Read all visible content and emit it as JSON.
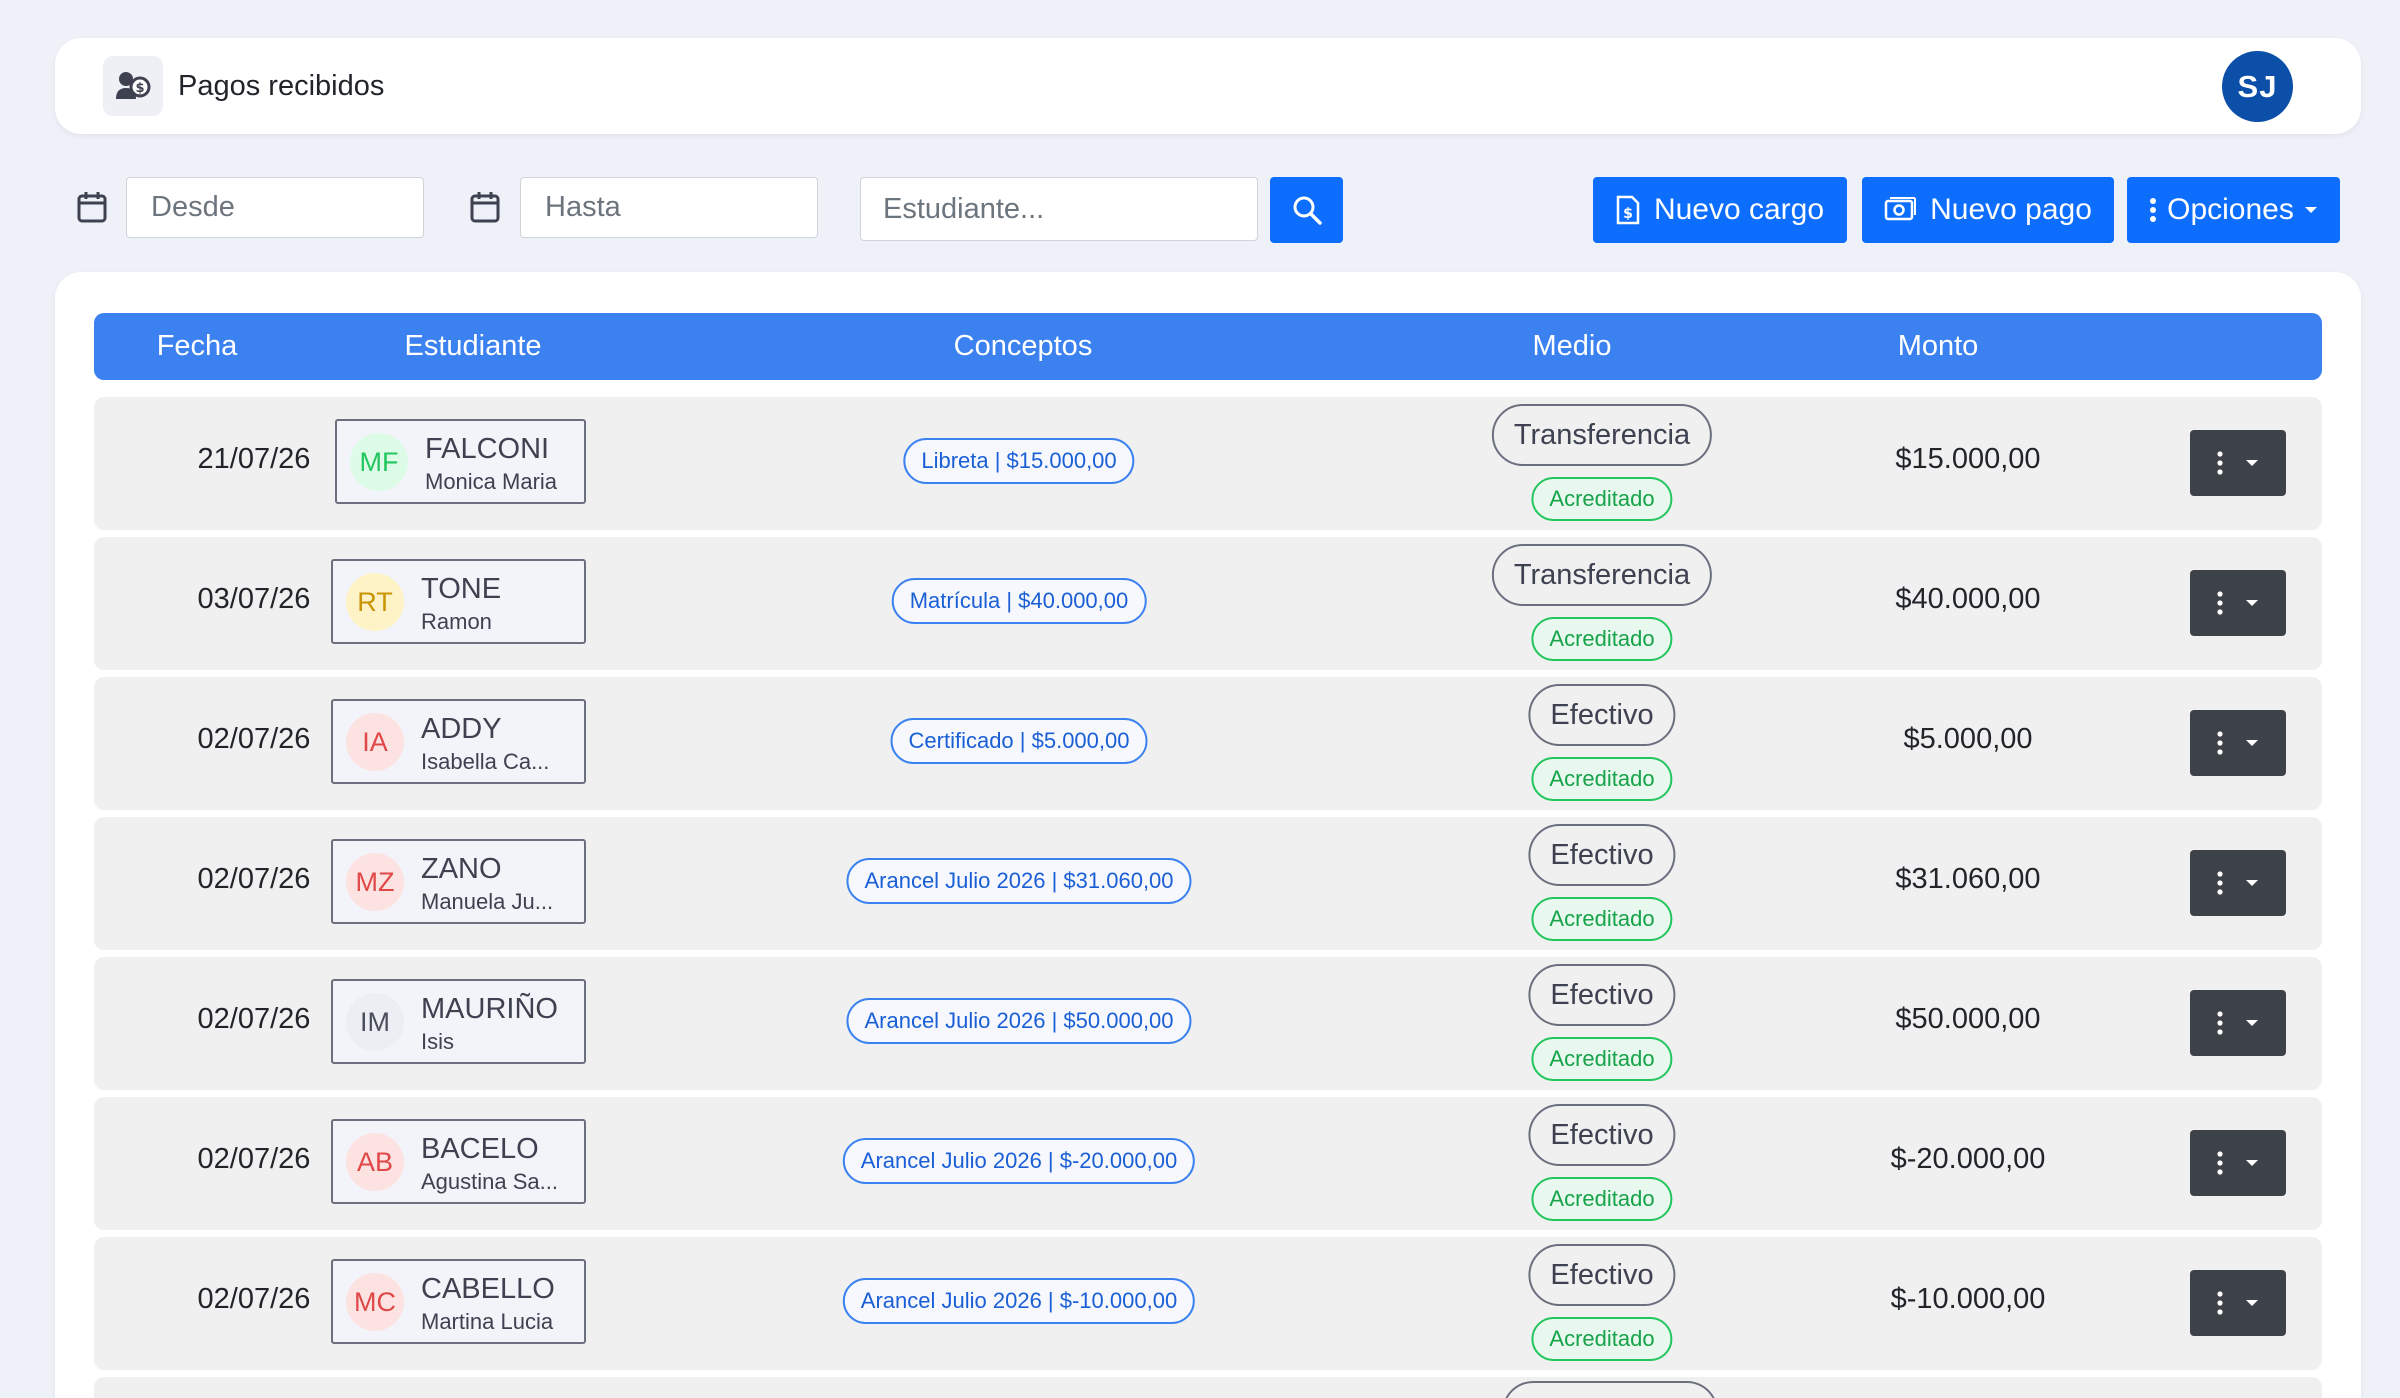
{
  "header": {
    "title": "Pagos recibidos",
    "avatar_initials": "SJ"
  },
  "toolbar": {
    "from_placeholder": "Desde",
    "to_placeholder": "Hasta",
    "student_placeholder": "Estudiante...",
    "new_charge_label": "Nuevo cargo",
    "new_payment_label": "Nuevo pago",
    "options_label": "Opciones"
  },
  "table": {
    "headers": [
      "Fecha",
      "Estudiante",
      "Conceptos",
      "Medio",
      "Monto"
    ],
    "rows": [
      {
        "date": "21/07/26",
        "initials": "MF",
        "last": "FALCONI",
        "first": "Monica Maria",
        "concept": "Libreta | $15.000,00",
        "medio": "Transferencia",
        "status": "Acreditado",
        "amount": "$15.000,00"
      },
      {
        "date": "03/07/26",
        "initials": "RT",
        "last": "TONE",
        "first": "Ramon",
        "concept": "Matrícula | $40.000,00",
        "medio": "Transferencia",
        "status": "Acreditado",
        "amount": "$40.000,00"
      },
      {
        "date": "02/07/26",
        "initials": "IA",
        "last": "ADDY",
        "first": "Isabella Ca...",
        "concept": "Certificado | $5.000,00",
        "medio": "Efectivo",
        "status": "Acreditado",
        "amount": "$5.000,00"
      },
      {
        "date": "02/07/26",
        "initials": "MZ",
        "last": "ZANO",
        "first": "Manuela Ju...",
        "concept": "Arancel Julio 2026 | $31.060,00",
        "medio": "Efectivo",
        "status": "Acreditado",
        "amount": "$31.060,00"
      },
      {
        "date": "02/07/26",
        "initials": "IM",
        "last": "MAURIÑO",
        "first": "Isis",
        "concept": "Arancel Julio 2026 | $50.000,00",
        "medio": "Efectivo",
        "status": "Acreditado",
        "amount": "$50.000,00"
      },
      {
        "date": "02/07/26",
        "initials": "AB",
        "last": "BACELO",
        "first": "Agustina Sa...",
        "concept": "Arancel Julio 2026 | $-20.000,00",
        "medio": "Efectivo",
        "status": "Acreditado",
        "amount": "$-20.000,00"
      },
      {
        "date": "02/07/26",
        "initials": "MC",
        "last": "CABELLO",
        "first": "Martina Lucia",
        "concept": "Arancel Julio 2026 | $-10.000,00",
        "medio": "Efectivo",
        "status": "Acreditado",
        "amount": "$-10.000,00"
      }
    ]
  },
  "colors": {
    "primary": "#0d6efd",
    "table_header": "#3b82f0",
    "success": "#22c55e",
    "action_button": "#3d4148",
    "avatar": "#0b4fa8"
  },
  "icons": {
    "header": "payments-icon",
    "date": "calendar-icon",
    "search": "search-icon",
    "new_charge": "invoice-icon",
    "new_payment": "money-icon",
    "options": "vertical-dots-icon"
  }
}
